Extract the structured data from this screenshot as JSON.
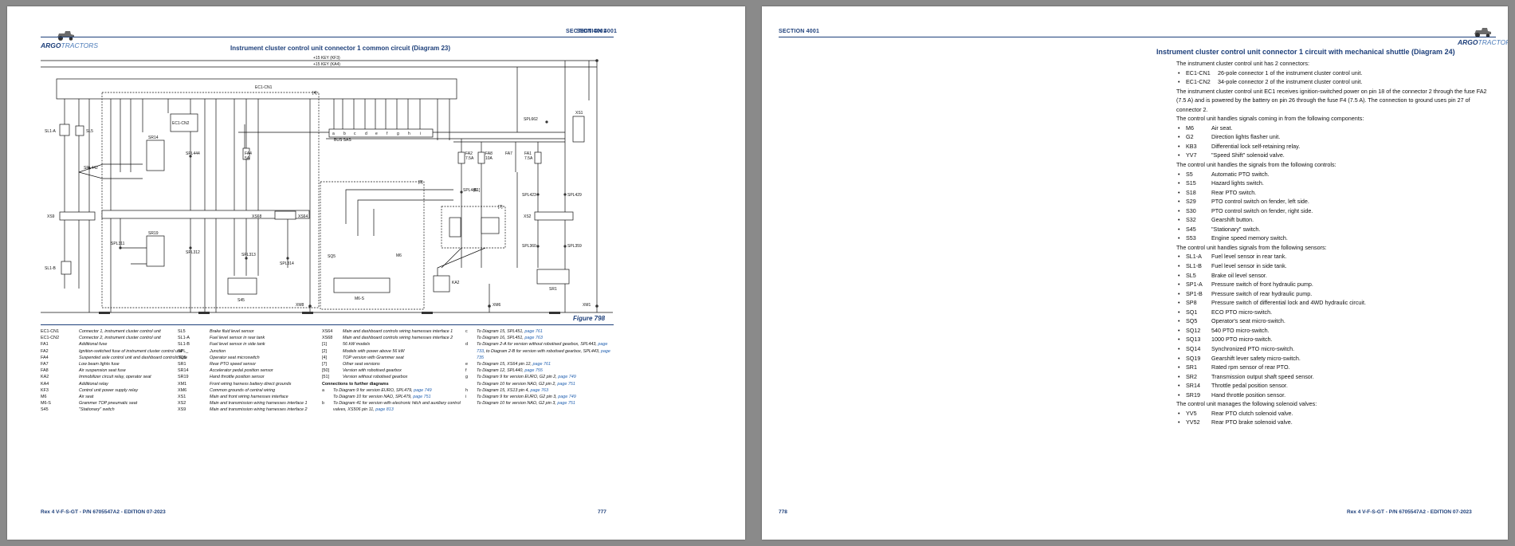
{
  "left": {
    "section": "SECTION 4001",
    "logo_brand": "ARGO",
    "logo_suffix": "TRACTORS",
    "title": "Instrument cluster control unit connector 1 common circuit  (Diagram 23)",
    "figure": "Figure 798",
    "footer_left": "Rex 4 V-F-S-GT - P/N 6705547A2 - EDITION 07-2023",
    "page_number": "777",
    "diagram_labels": {
      "key_kf3": "+15 KEY (KF3)",
      "key_ka4": "+15 KEY (KA4)",
      "ec1cn1": "EC1-CN1",
      "ec1cn2": "EC1-CN2",
      "sl1a": "SL1-A",
      "sl5": "SL5",
      "sl1b": "SL1-B",
      "sr14": "SR14",
      "sr19": "SR19",
      "spl442": "SPL442",
      "spl444": "SPL444",
      "spl311": "SPL311",
      "spl312": "SPL312",
      "spl313": "SPL313",
      "spl314": "SPL314",
      "spl662": "SPL662",
      "spl446": "SPL446",
      "spl423": "SPL423",
      "spl429": "SPL429",
      "spl360": "SPL360",
      "spl359": "SPL359",
      "xs9": "XS9",
      "xs68": "XS68",
      "xs64": "XS64",
      "xs1": "XS1",
      "xs2": "XS2",
      "fa4": "FA4",
      "fa4v": "5A",
      "fa2": "FA2",
      "fa2v": "7.5A",
      "fa8": "FA8",
      "fa8v": "10A",
      "fa7": "FA7",
      "fa1": "FA1",
      "fa1v": "7.5A",
      "s45": "S45",
      "sq5": "SQ5",
      "m6": "M6",
      "m6s": "M6-S",
      "ka2": "KA2",
      "sr1": "SR1",
      "xm8": "XM8",
      "xm6": "XM6",
      "xm1": "XM1",
      "bus_sas": "BUS SAS",
      "ref4": "[4]",
      "ref7": "[7]",
      "ref8": "[8]",
      "ref51": "[51]",
      "letters": [
        "a",
        "b",
        "c",
        "d",
        "e",
        "f",
        "g",
        "h",
        "i"
      ]
    },
    "legend": {
      "col1": [
        {
          "k": "EC1-CN1",
          "v": "Connector 1, instrument cluster control unit"
        },
        {
          "k": "EC1-CN2",
          "v": "Connector 2, instrument cluster control unit"
        },
        {
          "k": "FA1",
          "v": "Additional fuse"
        },
        {
          "k": "FA2",
          "v": "Ignition-switched fuse of instrument cluster control unit"
        },
        {
          "k": "FA4",
          "v": "Suspended axle control unit and dashboard controls fuse"
        },
        {
          "k": "FA7",
          "v": "Low beam lights fuse"
        },
        {
          "k": "FA8",
          "v": "Air suspension seat fuse"
        },
        {
          "k": "KA2",
          "v": "Immobilizer circuit relay, operator seat"
        },
        {
          "k": "KA4",
          "v": "Additional relay"
        },
        {
          "k": "KF3",
          "v": "Control unit power supply relay"
        },
        {
          "k": "M6",
          "v": "Air seat"
        },
        {
          "k": "M6-S",
          "v": "Grammer TOP pneumatic seat"
        },
        {
          "k": "S45",
          "v": "\"Stationary\" switch"
        }
      ],
      "col2": [
        {
          "k": "SL5",
          "v": "Brake fluid level sensor"
        },
        {
          "k": "SL1-A",
          "v": "Fuel level sensor in rear tank"
        },
        {
          "k": "SL1-B",
          "v": "Fuel level sensor in side tank"
        },
        {
          "k": "SPL_",
          "v": "Junction"
        },
        {
          "k": "SQ5",
          "v": "Operator seat microswitch"
        },
        {
          "k": "SR1",
          "v": "Rear PTO speed sensor"
        },
        {
          "k": "SR14",
          "v": "Accelerator pedal position sensor"
        },
        {
          "k": "SR19",
          "v": "Hand throttle position sensor"
        },
        {
          "k": "XM1",
          "v": "Front wiring harness battery direct grounds"
        },
        {
          "k": "XM6",
          "v": "Common grounds of central wiring"
        },
        {
          "k": "XS1",
          "v": "Main and front wiring harnesses interface"
        },
        {
          "k": "XS2",
          "v": "Main and transmission wiring harnesses interface 1"
        },
        {
          "k": "XS9",
          "v": "Main and transmission wiring harnesses interface 2"
        }
      ],
      "col3": [
        {
          "k": "XS64",
          "v": "Main and dashboard controls wiring harnesses interface 1"
        },
        {
          "k": "XS68",
          "v": "Main and dashboard controls wiring harnesses interface 2"
        },
        {
          "k": "[1]",
          "v": "56 kW models"
        },
        {
          "k": "[2]",
          "v": "Models with power above 56 kW"
        },
        {
          "k": "[4]",
          "v": "TOP version with Grammer seat"
        },
        {
          "k": "[7]",
          "v": "Other seat versions"
        },
        {
          "k": "[50]",
          "v": "Version with robotised gearbox"
        },
        {
          "k": "[51]",
          "v": "Version without robotised gearbox"
        }
      ],
      "conn_head": "Connections to further diagrams",
      "col3b": [
        {
          "k": "a",
          "t": "To Diagram 9 for version EURO, SPL479, ",
          "l": "page 749"
        },
        {
          "k": "",
          "t": "To Diagram 10 for version NAO, SPL479, ",
          "l": "page 751"
        },
        {
          "k": "b",
          "t": "To Diagram 41 for version with electronic hitch and auxiliary control valves, XS506 pin 11, ",
          "l": "page 813"
        }
      ],
      "col4": [
        {
          "k": "c",
          "t": "To Diagram 15, SPL451, ",
          "l": "page 761"
        },
        {
          "k": "",
          "t": "To Diagram 16, SPL451, ",
          "l": "page 763"
        },
        {
          "k": "d",
          "t": "To Diagram 2-A for version without robotised gearbox, SPL443, ",
          "l": "page 733",
          "t2": ", to Diagram 2-B for version with robotised gearbox, SPL443, ",
          "l2": "page 735"
        },
        {
          "k": "e",
          "t": "To Diagram 15, XS64 pin 12, ",
          "l": "page 761"
        },
        {
          "k": "f",
          "t": "To Diagram 12, SPL440, ",
          "l": "page 755"
        },
        {
          "k": "g",
          "t": "To Diagram 9 for version EURO, G2 pin 2, ",
          "l": "page 749"
        },
        {
          "k": "",
          "t": "To Diagram 10 for version NAO, G2 pin 2, ",
          "l": "page 751"
        },
        {
          "k": "h",
          "t": "To Diagram 15, XS13 pin 4, ",
          "l": "page 763"
        },
        {
          "k": "i",
          "t": "To Diagram 9 for version EURO, G2 pin 3, ",
          "l": "page 749"
        },
        {
          "k": "",
          "t": "To Diagram 10 for version NAO, G2 pin 3, ",
          "l": "page 751"
        }
      ]
    }
  },
  "right": {
    "section": "SECTION 4001",
    "logo_brand": "ARGO",
    "logo_suffix": "TRACTORS",
    "title": "Instrument cluster control unit connector 1 circuit with mechanical shuttle (Diagram 24)",
    "footer_left": "778",
    "footer_right": "Rex 4 V-F-S-GT - P/N 6705547A2 - EDITION 07-2023",
    "intro": "The instrument cluster control unit has 2 connectors:",
    "connectors": [
      {
        "k": "EC1-CN1",
        "v": "26-pole connector 1 of the instrument cluster control unit."
      },
      {
        "k": "EC1-CN2",
        "v": "34-pole connector 2 of the instrument cluster control unit."
      }
    ],
    "power_text": "The instrument cluster control unit EC1 receives ignition-switched power on pin 18 of the connector 2 through the fuse FA2 (7.5 A) and is powered by the battery on pin 26 through the fuse F4 (7.5 A). The connection to ground uses pin 27 of connector 2.",
    "components_head": "The control unit handles signals coming in from the following components:",
    "components": [
      {
        "k": "M6",
        "v": "Air seat."
      },
      {
        "k": "G2",
        "v": "Direction lights flasher unit."
      },
      {
        "k": "KB3",
        "v": "Differential lock self-retaining relay."
      },
      {
        "k": "YV7",
        "v": "\"Speed Shift\" solenoid valve."
      }
    ],
    "controls_head": "The control unit handles the signals from the following controls:",
    "controls": [
      {
        "k": "S5",
        "v": "Automatic PTO switch."
      },
      {
        "k": "S15",
        "v": "Hazard lights switch."
      },
      {
        "k": "S18",
        "v": "Rear PTO switch."
      },
      {
        "k": "S29",
        "v": "PTO control switch on fender, left side."
      },
      {
        "k": "S30",
        "v": "PTO control switch on fender, right side."
      },
      {
        "k": "S32",
        "v": "Gearshift button."
      },
      {
        "k": "S45",
        "v": "\"Stationary\" switch."
      },
      {
        "k": "S53",
        "v": "Engine speed memory switch."
      }
    ],
    "sensors_head": "The control unit handles signals from the following sensors:",
    "sensors": [
      {
        "k": "SL1-A",
        "v": "Fuel level sensor in rear tank."
      },
      {
        "k": "SL1-B",
        "v": "Fuel level sensor in side tank."
      },
      {
        "k": "SL5",
        "v": "Brake oil level sensor."
      },
      {
        "k": "SP1-A",
        "v": "Pressure switch of front hydraulic pump."
      },
      {
        "k": "SP1-B",
        "v": "Pressure switch of rear hydraulic pump."
      },
      {
        "k": "SP8",
        "v": "Pressure switch of differential lock and 4WD hydraulic circuit."
      },
      {
        "k": "SQ1",
        "v": "ECO PTO micro-switch."
      },
      {
        "k": "SQ5",
        "v": "Operator's seat micro-switch."
      },
      {
        "k": "SQ12",
        "v": "540 PTO micro-switch."
      },
      {
        "k": "SQ13",
        "v": "1000 PTO micro-switch."
      },
      {
        "k": "SQ14",
        "v": "Synchronized PTO micro-switch."
      },
      {
        "k": "SQ19",
        "v": "Gearshift lever safety micro-switch."
      },
      {
        "k": "SR1",
        "v": "Rated rpm sensor of rear PTO."
      },
      {
        "k": "SR2",
        "v": "Transmission output shaft speed sensor."
      },
      {
        "k": "SR14",
        "v": "Throttle pedal position sensor."
      },
      {
        "k": "SR19",
        "v": "Hand throttle position sensor."
      }
    ],
    "valves_head": "The control unit manages the following solenoid valves:",
    "valves": [
      {
        "k": "YV5",
        "v": "Rear PTO clutch solenoid valve."
      },
      {
        "k": "YV52",
        "v": "Rear PTO brake solenoid valve."
      }
    ]
  }
}
